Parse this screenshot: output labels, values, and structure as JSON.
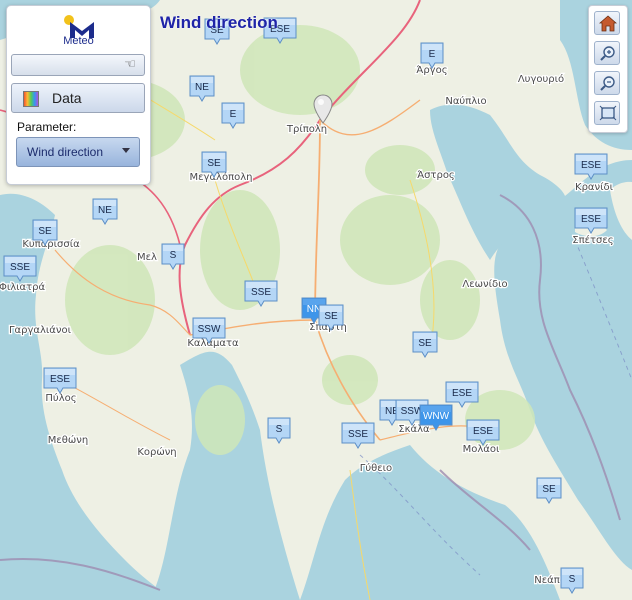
{
  "map_title": "Wind direction",
  "panel": {
    "logo_text": "Meteo",
    "data_button_label": "Data",
    "parameter_label": "Parameter:",
    "parameter_value": "Wind direction"
  },
  "toolbar": {
    "icons": [
      "home-icon",
      "zoom-in-icon",
      "zoom-out-icon",
      "zoom-extent-icon"
    ]
  },
  "colors": {
    "title": "#1f24a8",
    "sea": "#aad3df",
    "land": "#eef0e4",
    "forest": "#cfe6b8",
    "marker_light": "#b4d6f6",
    "marker_dark": "#3d95ea"
  },
  "place_labels": [
    "Άργος",
    "Λυγουριό",
    "Ναύπλιο",
    "Τρίπολη",
    "Άστρος",
    "Κρανίδι",
    "Σπέτσες",
    "Μεγαλόπολη",
    "Κυπαρισσία",
    "Φιλιατρά",
    "Μελ",
    "Γαργαλιάνοι",
    "Καλαματα",
    "Σπαρτη",
    "Λεωνίδιο",
    "Πύλος",
    "Μεθώνη",
    "Κορώνη",
    "Σκάλα",
    "Μολάοι",
    "Γύθειο",
    "Νεάπ"
  ],
  "stations": [
    {
      "dir": "SE",
      "dark": false
    },
    {
      "dir": "ESE",
      "dark": false
    },
    {
      "dir": "E",
      "dark": false
    },
    {
      "dir": "NE",
      "dark": false
    },
    {
      "dir": "E",
      "dark": false
    },
    {
      "dir": "SE",
      "dark": false
    },
    {
      "dir": "NE",
      "dark": false
    },
    {
      "dir": "SE",
      "dark": false
    },
    {
      "dir": "SSE",
      "dark": false
    },
    {
      "dir": "S",
      "dark": false
    },
    {
      "dir": "SSE",
      "dark": false
    },
    {
      "dir": "SSW",
      "dark": false
    },
    {
      "dir": "NN",
      "dark": true
    },
    {
      "dir": "SE",
      "dark": false
    },
    {
      "dir": "SE",
      "dark": false
    },
    {
      "dir": "ESE",
      "dark": false
    },
    {
      "dir": "ESE",
      "dark": false
    },
    {
      "dir": "ESE",
      "dark": false
    },
    {
      "dir": "ESE",
      "dark": false
    },
    {
      "dir": "NE",
      "dark": false
    },
    {
      "dir": "SSW",
      "dark": false
    },
    {
      "dir": "WNW",
      "dark": true
    },
    {
      "dir": "ESE",
      "dark": false
    },
    {
      "dir": "S",
      "dark": false
    },
    {
      "dir": "SSE",
      "dark": false
    },
    {
      "dir": "SE",
      "dark": false
    },
    {
      "dir": "S",
      "dark": false
    }
  ]
}
